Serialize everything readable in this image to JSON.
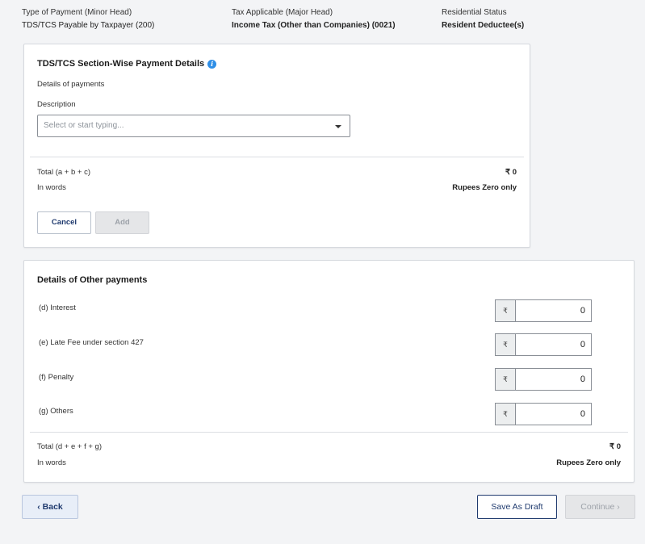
{
  "header": {
    "minor_head_label": "Type of Payment (Minor Head)",
    "minor_head_value": "TDS/TCS Payable by Taxpayer (200)",
    "major_head_label": "Tax Applicable (Major Head)",
    "major_head_value": "Income Tax (Other than Companies) (0021)",
    "residential_label": "Residential Status",
    "residential_value": "Resident Deductee(s)"
  },
  "section_wise": {
    "title": "TDS/TCS Section-Wise Payment Details",
    "details_label": "Details of payments",
    "description_label": "Description",
    "description_placeholder": "Select or start typing...",
    "total_label": "Total (a + b + c)",
    "total_value": "₹ 0",
    "in_words_label": "In words",
    "in_words_value": "Rupees Zero only",
    "cancel_label": "Cancel",
    "add_label": "Add"
  },
  "other_payments": {
    "title": "Details of Other payments",
    "currency_symbol": "₹",
    "items": [
      {
        "label": "(d) Interest",
        "value": "0"
      },
      {
        "label": "(e) Late Fee under section 427",
        "value": "0"
      },
      {
        "label": "(f) Penalty",
        "value": "0"
      },
      {
        "label": "(g) Others",
        "value": "0"
      }
    ],
    "total_label": "Total (d + e + f + g)",
    "total_value": "₹ 0",
    "in_words_label": "In words",
    "in_words_value": "Rupees Zero only"
  },
  "footer": {
    "back_label": "Back",
    "save_draft_label": "Save As Draft",
    "continue_label": "Continue"
  },
  "colors": {
    "accent": "#1f3a6e",
    "info": "#2e8ee6"
  }
}
